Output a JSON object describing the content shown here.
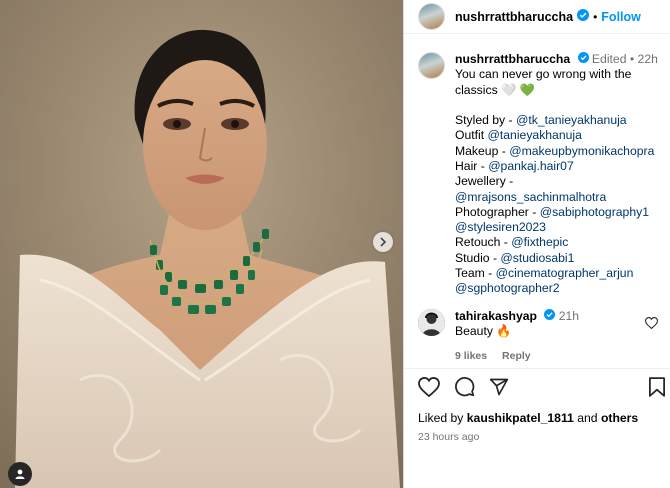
{
  "post": {
    "username": "nushrrattbharuccha",
    "follow_label": "Follow",
    "dot": "•"
  },
  "caption": {
    "username": "nushrrattbharuccha",
    "edited": "Edited",
    "dot": "•",
    "age": "22h",
    "line1": "You can never go wrong with the",
    "line2": "classics 🤍 💚",
    "credits": [
      {
        "label": "Styled by - ",
        "mention": "@tk_tanieyakhanuja"
      },
      {
        "label": "Outfit ",
        "mention": "@tanieyakhanuja"
      },
      {
        "label": "Makeup - ",
        "mention": "@makeupbymonikachopra"
      },
      {
        "label": "Hair - ",
        "mention": "@pankaj.hair07"
      },
      {
        "label": "Jewellery - ",
        "mention": "@mrajsons_sachinmalhotra"
      },
      {
        "label": "Photographer - ",
        "mention": "@sabiphotography1"
      },
      {
        "label": "",
        "mention": "@stylesiren2023"
      },
      {
        "label": "Retouch - ",
        "mention": "@fixthepic"
      },
      {
        "label": "Studio - ",
        "mention": "@studiosabi1"
      },
      {
        "label": "Team - ",
        "mention": "@cinematographer_arjun"
      },
      {
        "label": "",
        "mention": "@sgphotographer2"
      }
    ]
  },
  "comment": {
    "username": "tahirakashyap",
    "age": "21h",
    "text": "Beauty 🔥",
    "likes": "9 likes",
    "reply": "Reply"
  },
  "footer": {
    "liked_by_prefix": "Liked by ",
    "liked_by_user": "kaushikpatel_1811",
    "and": " and ",
    "others": "others",
    "timestamp": "23 hours ago"
  },
  "colors": {
    "accent": "#0095f6",
    "mention": "#00376b",
    "muted": "#737373",
    "verified": "#0095f6"
  },
  "icons": [
    "chevron-right-icon",
    "user-tag-icon",
    "verified-badge-icon",
    "heart-icon",
    "comment-icon",
    "share-icon",
    "bookmark-icon"
  ]
}
